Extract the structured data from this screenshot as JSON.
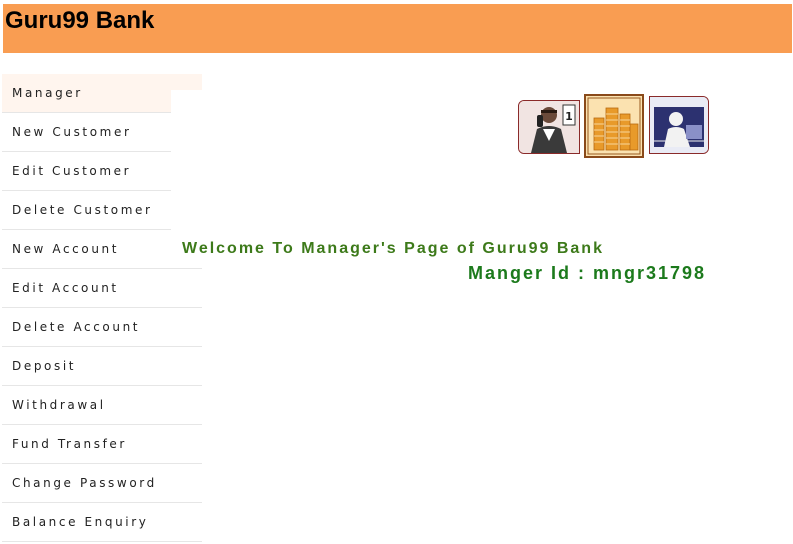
{
  "header": {
    "brand": "Guru99 Bank",
    "background_color": "#f99d52"
  },
  "menu": {
    "items": [
      {
        "label": "Manager",
        "active": true
      },
      {
        "label": "New Customer"
      },
      {
        "label": "Edit Customer"
      },
      {
        "label": "Delete Customer"
      },
      {
        "label": "New Account"
      },
      {
        "label": "Edit Account"
      },
      {
        "label": "Delete Account"
      },
      {
        "label": "Deposit"
      },
      {
        "label": "Withdrawal"
      },
      {
        "label": "Fund Transfer"
      },
      {
        "label": "Change Password"
      },
      {
        "label": "Balance Enquiry"
      }
    ]
  },
  "banner": {
    "images": [
      "man-on-phone-photo",
      "coin-stacks-photo",
      "woman-at-computer-photo"
    ]
  },
  "main": {
    "welcome": "Welcome To Manager's Page of Guru99 Bank",
    "manager_id": "Manger Id : mngr31798"
  },
  "colors": {
    "welcome_text": "#3d7a1a",
    "manager_id_text": "#1c7a1c"
  }
}
